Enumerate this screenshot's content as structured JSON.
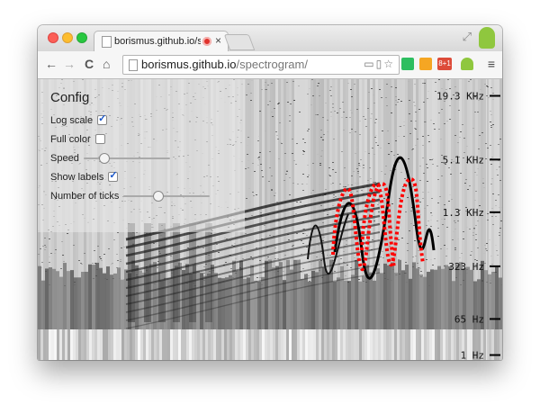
{
  "browser": {
    "tab_title": "borismus.github.io/spe",
    "tab_close": "×",
    "url_host": "borismus.github.io",
    "url_path": "/spectrogram/",
    "nav_back": "←",
    "nav_forward": "→",
    "nav_reload": "C",
    "nav_home": "⌂",
    "menu_icon": "≡",
    "fullscreen_icon": "⤢",
    "extension_badge": "8+1",
    "colors": {
      "record_indicator": "#e0312b",
      "ext_evernote": "#2dbe60",
      "ext_folder": "#f5a623",
      "ext_android": "#8fc73e"
    }
  },
  "config": {
    "heading": "Config",
    "log_scale": {
      "label": "Log scale",
      "checked": true
    },
    "full_color": {
      "label": "Full color",
      "checked": false
    },
    "speed": {
      "label": "Speed",
      "value": 0.2
    },
    "show_labels": {
      "label": "Show labels",
      "checked": true
    },
    "number_of_ticks": {
      "label": "Number of ticks",
      "value": 0.38
    }
  },
  "spectrogram": {
    "colormap": "grayscale",
    "overlay_color": "#ff0000",
    "frequency_axis": {
      "scale": "log",
      "ticks": [
        "19.3 KHz",
        "5.1 KHz",
        "1.3 KHz",
        "323 Hz",
        "65 Hz",
        "1 Hz"
      ]
    }
  }
}
